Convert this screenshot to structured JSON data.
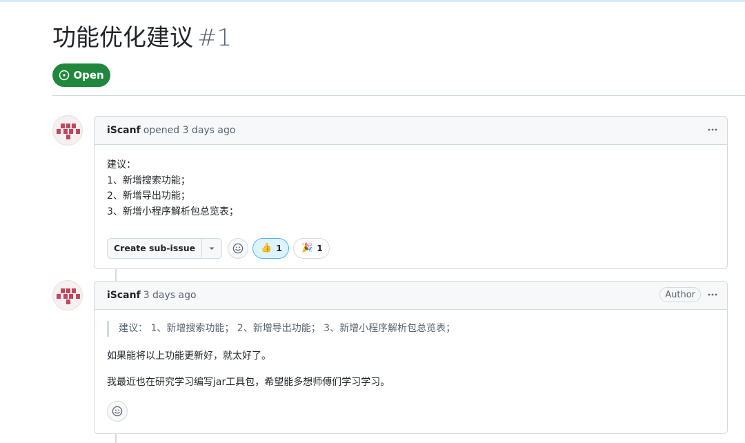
{
  "issue": {
    "title": "功能优化建议",
    "number": "#1",
    "state": "Open"
  },
  "comments": [
    {
      "author": "iScanf",
      "meta": "opened 3 days ago",
      "body_lines": [
        "建议：",
        "1、新增搜索功能；",
        "2、新增导出功能；",
        "3、新增小程序解析包总览表；"
      ],
      "create_subissue_label": "Create sub-issue",
      "reactions": [
        {
          "icon": "thumbs-up-icon",
          "emoji": "👍",
          "count": "1",
          "active": true
        },
        {
          "icon": "hooray-icon",
          "emoji": "🎉",
          "count": "1",
          "active": false
        }
      ]
    },
    {
      "author": "iScanf",
      "meta": "3 days ago",
      "badge": "Author",
      "quote": "建议： 1、新增搜索功能； 2、新增导出功能； 3、新增小程序解析包总览表；",
      "paragraphs": [
        "如果能将以上功能更新好，就太好了。",
        "我最近也在研究学习编写jar工具包，希望能多想师傅们学习学习。"
      ]
    }
  ],
  "colors": {
    "open_green": "#1f883d",
    "active_reaction_bg": "#ddf4ff",
    "active_reaction_border": "#54aeff",
    "border": "#d1d9e0",
    "header_bg": "#f6f8fa",
    "muted_text": "#59636e",
    "avatar_red": "#c0475c"
  }
}
